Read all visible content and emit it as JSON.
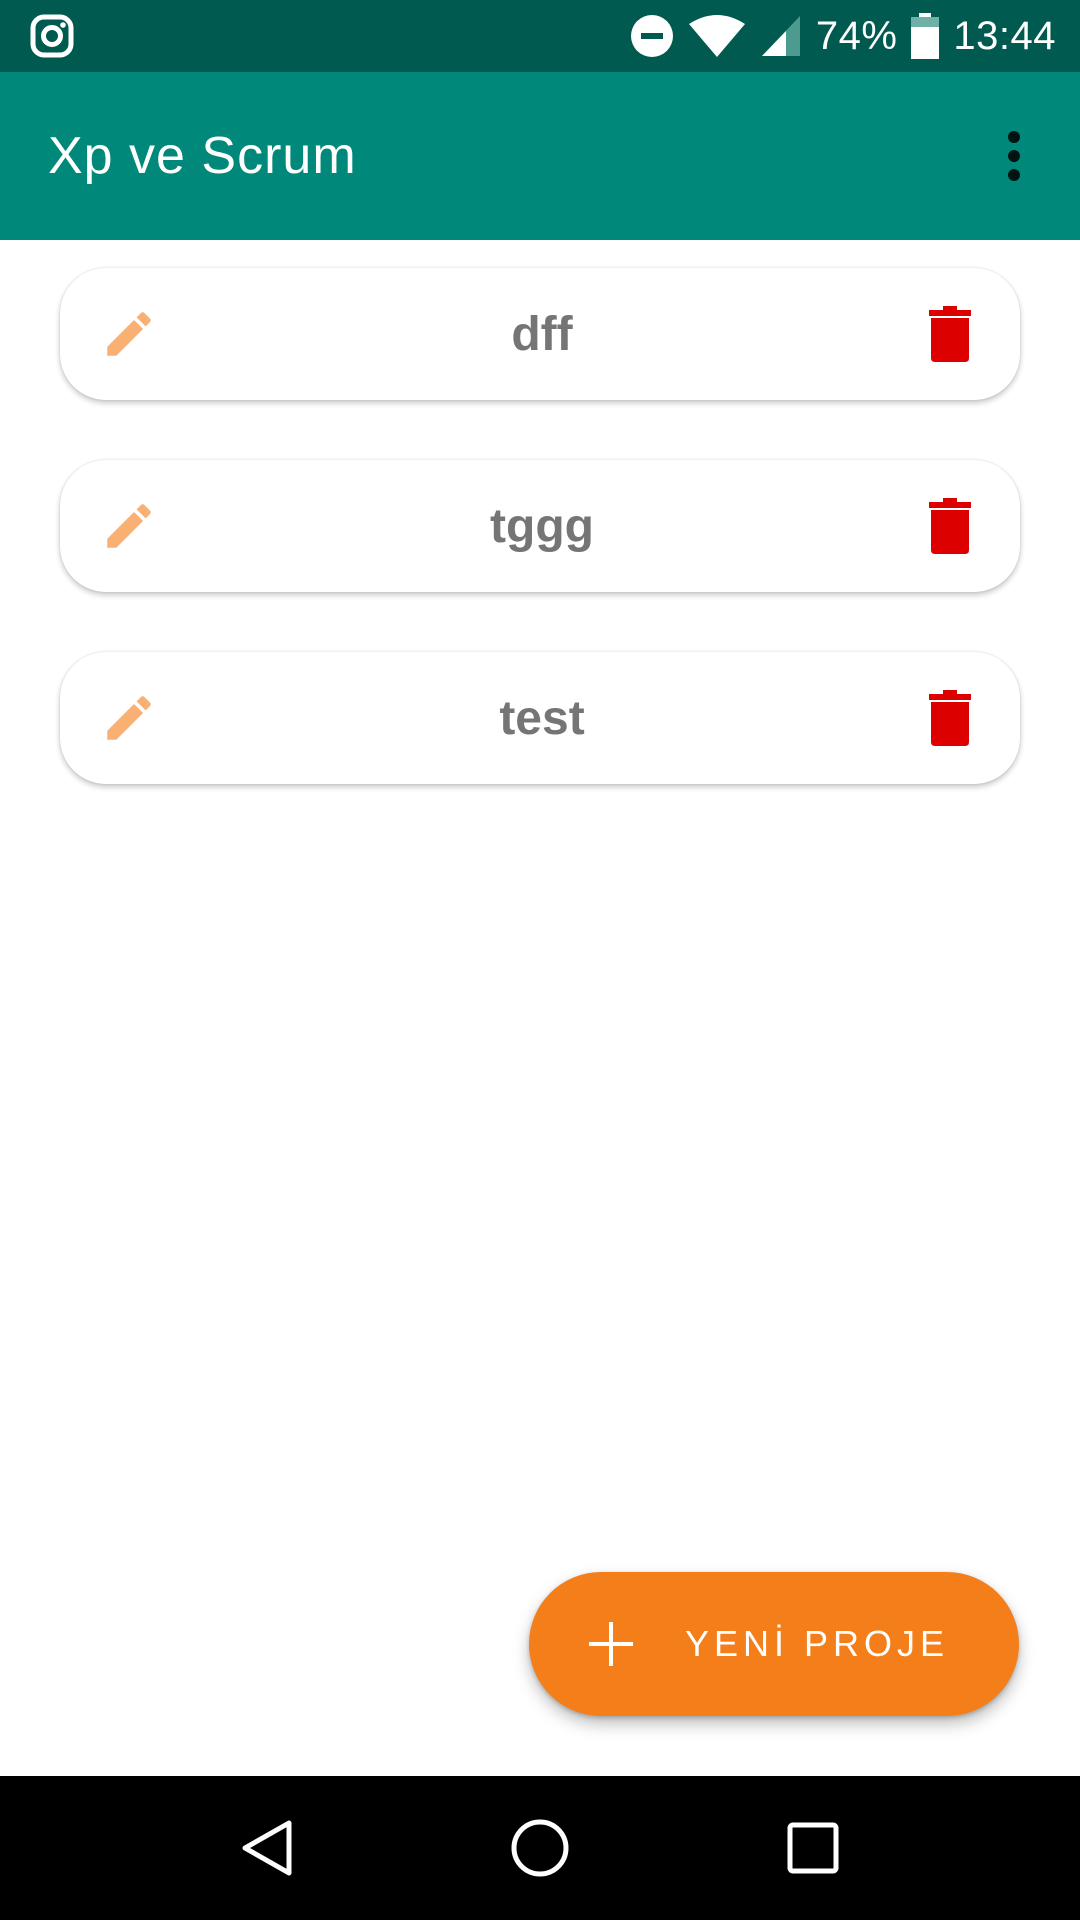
{
  "status_bar": {
    "battery": "74%",
    "time": "13:44",
    "icons": [
      "instagram-icon",
      "do-not-disturb-icon",
      "wifi-icon",
      "cell-signal-icon",
      "battery-icon"
    ]
  },
  "app_bar": {
    "title": "Xp ve Scrum",
    "menu_icon": "more-vert-icon"
  },
  "projects": [
    {
      "name": "dff"
    },
    {
      "name": "tggg"
    },
    {
      "name": "test"
    }
  ],
  "fab": {
    "label": "YENİ PROJE",
    "icon": "plus-icon"
  },
  "nav_bar": {
    "icons": [
      "back-icon",
      "home-icon",
      "recents-icon"
    ]
  },
  "colors": {
    "status_bar": "#005a4f",
    "app_bar": "#00897b",
    "edit_icon": "#f9b072",
    "delete_icon": "#dd0000",
    "fab": "#f47f1a",
    "card_text": "#757575"
  }
}
